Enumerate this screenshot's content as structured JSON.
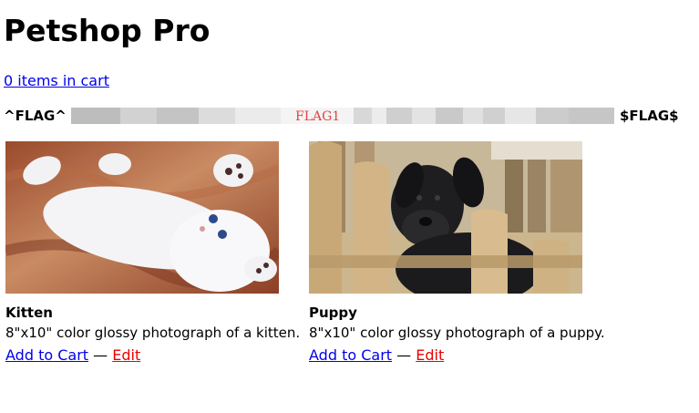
{
  "header": {
    "title": "Petshop Pro",
    "cart_link": "0 items in cart"
  },
  "flag": {
    "start": "^FLAG^",
    "inner": "FLAG1",
    "end": "$FLAG$"
  },
  "products": [
    {
      "name": "Kitten",
      "description": "8\"x10\" color glossy photograph of a kitten.",
      "add_label": "Add to Cart",
      "separator": "—",
      "edit_label": "Edit",
      "image": "kitten-photo"
    },
    {
      "name": "Puppy",
      "description": "8\"x10\" color glossy photograph of a puppy.",
      "add_label": "Add to Cart",
      "separator": "—",
      "edit_label": "Edit",
      "image": "puppy-photo"
    }
  ],
  "colors": {
    "link": "#0000ee",
    "edit_link": "#ee0000",
    "flag_text": "#e04545"
  }
}
